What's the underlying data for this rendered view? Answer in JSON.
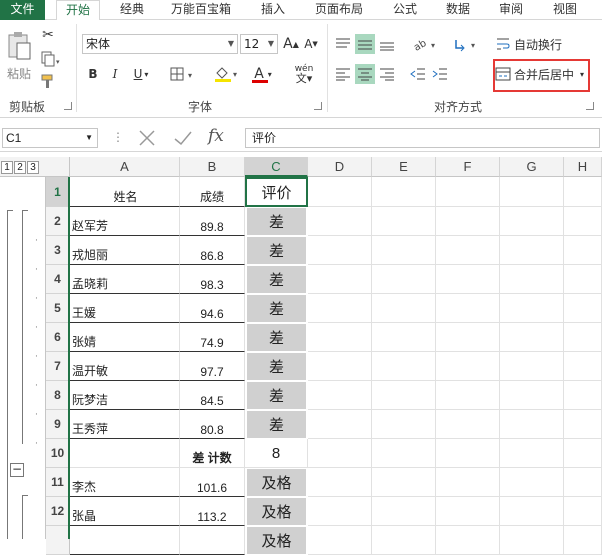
{
  "tabs": [
    "文件",
    "开始",
    "经典",
    "万能百宝箱",
    "插入",
    "页面布局",
    "公式",
    "数据",
    "审阅",
    "视图"
  ],
  "clipboard": {
    "paste_label": "粘贴",
    "group_label": "剪贴板"
  },
  "font": {
    "name": "宋体",
    "size": "12",
    "bold": "B",
    "italic": "I",
    "underline": "U",
    "color_glyph": "A",
    "phonetic": "wén",
    "grow": "A",
    "shrink": "A",
    "group_label": "字体"
  },
  "alignment": {
    "wrap_text": "自动换行",
    "merge_center": "合并后居中",
    "group_label": "对齐方式"
  },
  "formula_bar": {
    "name_box": "C1",
    "fx": "fx",
    "content": "评价"
  },
  "outline_levels": [
    "1",
    "2",
    "3"
  ],
  "collapse_symbol": "−",
  "columns": [
    "A",
    "B",
    "C",
    "D",
    "E",
    "F",
    "G",
    "H"
  ],
  "rows": [
    {
      "num": "1",
      "a": "姓名",
      "b": "成绩",
      "c": "评价"
    },
    {
      "num": "2",
      "a": "赵军芳",
      "b": "89.8",
      "c": "差"
    },
    {
      "num": "3",
      "a": "戎旭丽",
      "b": "86.8",
      "c": "差"
    },
    {
      "num": "4",
      "a": "孟晓莉",
      "b": "98.3",
      "c": "差"
    },
    {
      "num": "5",
      "a": "王媛",
      "b": "94.6",
      "c": "差"
    },
    {
      "num": "6",
      "a": "张婧",
      "b": "74.9",
      "c": "差"
    },
    {
      "num": "7",
      "a": "温开敏",
      "b": "97.7",
      "c": "差"
    },
    {
      "num": "8",
      "a": "阮梦洁",
      "b": "84.5",
      "c": "差"
    },
    {
      "num": "9",
      "a": "王秀萍",
      "b": "80.8",
      "c": "差"
    },
    {
      "num": "10",
      "a": "",
      "b": "差 计数",
      "c": "8"
    },
    {
      "num": "11",
      "a": "李杰",
      "b": "101.6",
      "c": "及格"
    },
    {
      "num": "12",
      "a": "张晶",
      "b": "113.2",
      "c": "及格"
    },
    {
      "num": "",
      "a": "",
      "b": "",
      "c": "及格"
    }
  ],
  "colors": {
    "accent": "#217346",
    "highlight": "#e53935",
    "eval_fill": "#d0d0d0"
  }
}
